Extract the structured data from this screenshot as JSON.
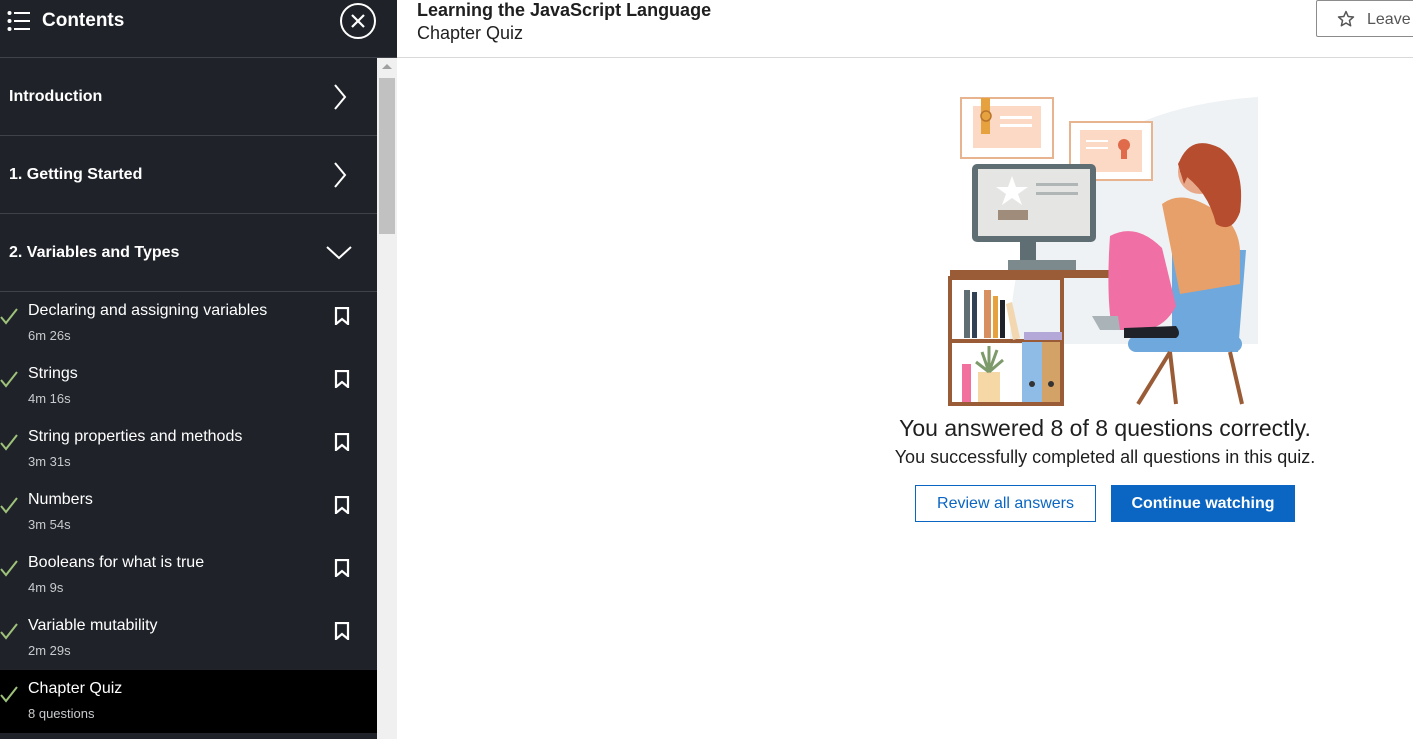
{
  "sidebar": {
    "title": "Contents",
    "sections": [
      {
        "label": "Introduction",
        "state": "collapsed"
      },
      {
        "label": "1. Getting Started",
        "state": "collapsed"
      },
      {
        "label": "2. Variables and Types",
        "state": "expanded"
      }
    ],
    "items": [
      {
        "name": "Declaring and assigning variables",
        "duration": "6m 26s"
      },
      {
        "name": "Strings",
        "duration": "4m 16s"
      },
      {
        "name": "String properties and methods",
        "duration": "3m 31s"
      },
      {
        "name": "Numbers",
        "duration": "3m 54s"
      },
      {
        "name": "Booleans for what is true",
        "duration": "4m 9s"
      },
      {
        "name": "Variable mutability",
        "duration": "2m 29s"
      },
      {
        "name": "Chapter Quiz",
        "duration": "8 questions"
      }
    ]
  },
  "header": {
    "course_title": "Learning the JavaScript Language",
    "subtitle": "Chapter Quiz",
    "leave_label": "Leave"
  },
  "main": {
    "result_title": "You answered 8 of 8 questions correctly.",
    "result_subtitle": "You successfully completed all questions in this quiz.",
    "review_label": "Review all answers",
    "continue_label": "Continue watching"
  },
  "colors": {
    "sidebar_bg": "#1f2329",
    "check_green": "#9ec27a",
    "primary_blue": "#0a66c2"
  }
}
